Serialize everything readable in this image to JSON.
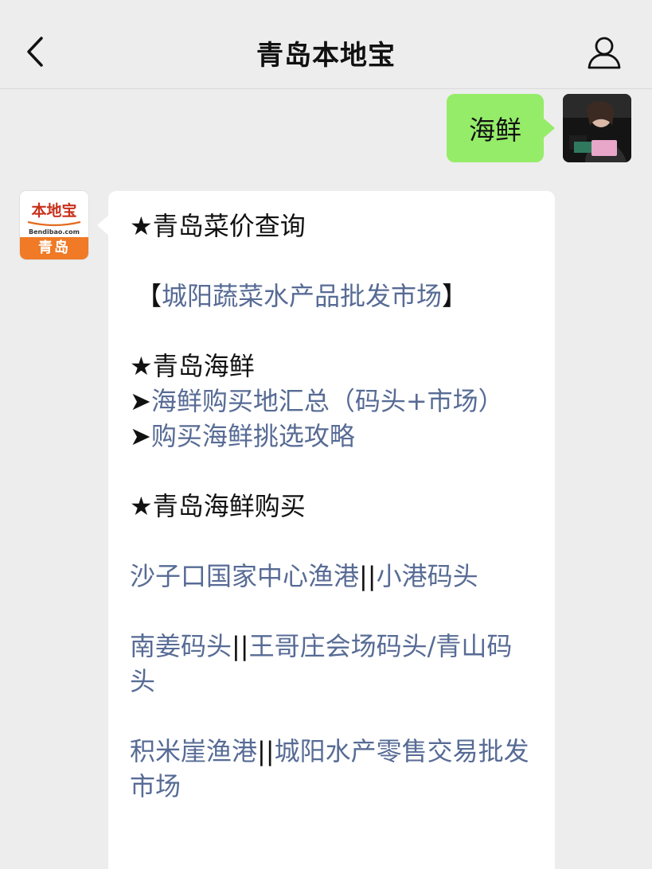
{
  "header": {
    "title": "青岛本地宝"
  },
  "outgoing": {
    "text": "海鲜"
  },
  "bot": {
    "logo_main": "本地宝",
    "logo_sub": "Bendibao.com",
    "logo_city": "青岛"
  },
  "message": {
    "section1_title": "★青岛菜价查询",
    "link_market_bracket_open": "【",
    "link_market": "城阳蔬菜水产品批发市场",
    "link_market_bracket_close": "】",
    "section2_title": "★青岛海鲜",
    "arrow1": "➤",
    "link_where_to_buy": "海鲜购买地汇总（码头+市场）",
    "arrow2": "➤",
    "link_tips": "购买海鲜挑选攻略",
    "section3_title": "★青岛海鲜购买",
    "link_shazikou": "沙子口国家中心渔港",
    "sep1": "||",
    "link_xiaogang": "小港码头",
    "link_nanjiang": "南姜码头",
    "sep2": "||",
    "link_wanggezhuang": "王哥庄会场码头/青山码头",
    "link_jimiya": "积米崖渔港",
    "sep3": "||",
    "link_chengyang_retail": "城阳水产零售交易批发市场"
  }
}
